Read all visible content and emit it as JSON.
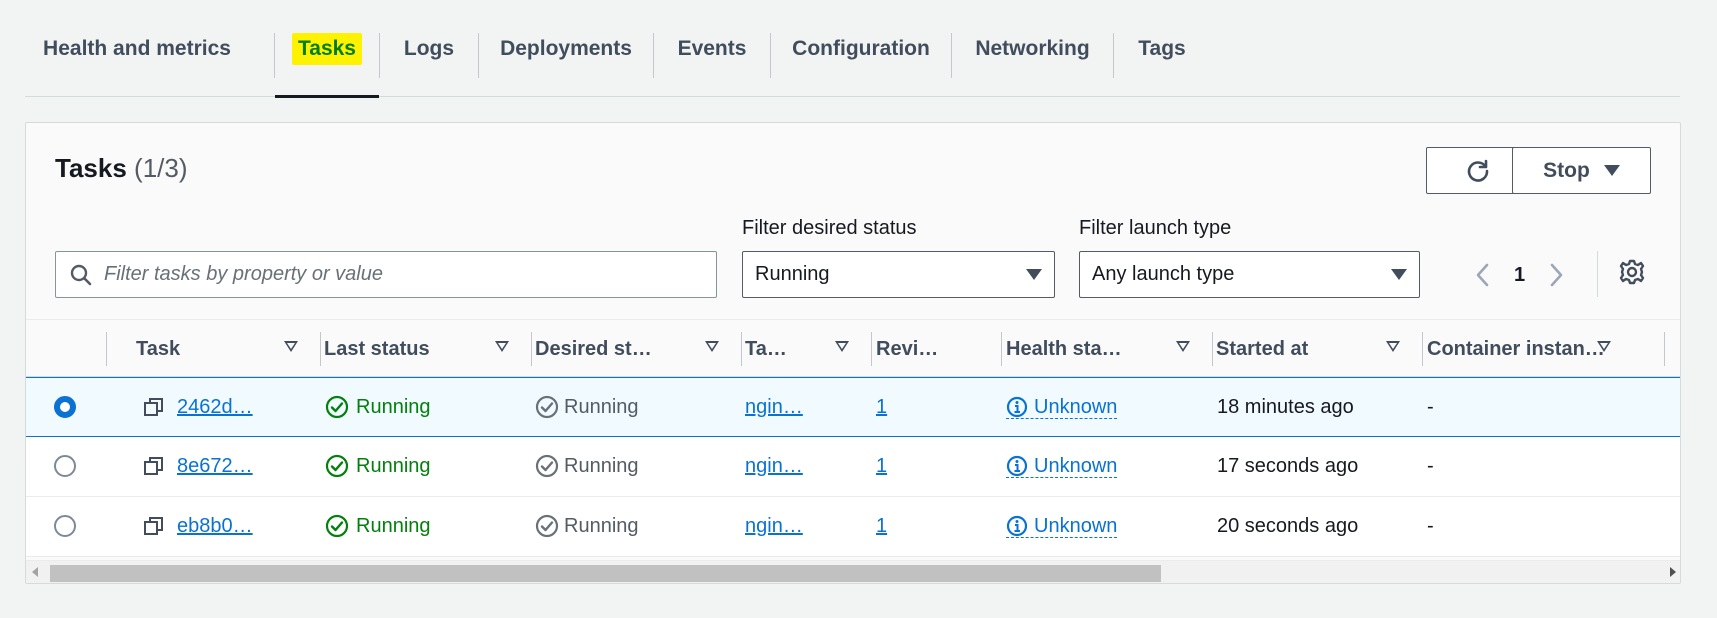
{
  "tabs": [
    {
      "label": "Health and metrics"
    },
    {
      "label": "Tasks"
    },
    {
      "label": "Logs"
    },
    {
      "label": "Deployments"
    },
    {
      "label": "Events"
    },
    {
      "label": "Configuration"
    },
    {
      "label": "Networking"
    },
    {
      "label": "Tags"
    }
  ],
  "active_tab": "Tasks",
  "panel": {
    "title": "Tasks",
    "count": "(1/3)",
    "stop_label": "Stop",
    "search_placeholder": "Filter tasks by property or value",
    "filter_status_label": "Filter desired status",
    "filter_status_value": "Running",
    "filter_launch_label": "Filter launch type",
    "filter_launch_value": "Any launch type",
    "page": "1"
  },
  "table": {
    "columns": [
      "Task",
      "Last status",
      "Desired st…",
      "Ta…",
      "Revi…",
      "Health sta…",
      "Started at",
      "Container instan…"
    ],
    "rows": [
      {
        "selected": true,
        "task": "2462d…",
        "last_status": "Running",
        "desired": "Running",
        "task_def": "ngin…",
        "revision": "1",
        "health": "Unknown",
        "started": "18 minutes ago",
        "container": "-"
      },
      {
        "selected": false,
        "task": "8e672…",
        "last_status": "Running",
        "desired": "Running",
        "task_def": "ngin…",
        "revision": "1",
        "health": "Unknown",
        "started": "17 seconds ago",
        "container": "-"
      },
      {
        "selected": false,
        "task": "eb8b0…",
        "last_status": "Running",
        "desired": "Running",
        "task_def": "ngin…",
        "revision": "1",
        "health": "Unknown",
        "started": "20 seconds ago",
        "container": "-"
      }
    ]
  },
  "icons": {
    "refresh": "refresh-icon",
    "search": "search-icon",
    "settings": "gear-icon",
    "copy": "copy-icon",
    "status_ok": "check-circle-icon",
    "status_desired": "check-circle-outline-icon",
    "info": "info-icon"
  },
  "colors": {
    "highlight": "#fff200",
    "link": "#0972d3",
    "success": "#037f0c",
    "selected_row_bg": "#f1faff"
  }
}
